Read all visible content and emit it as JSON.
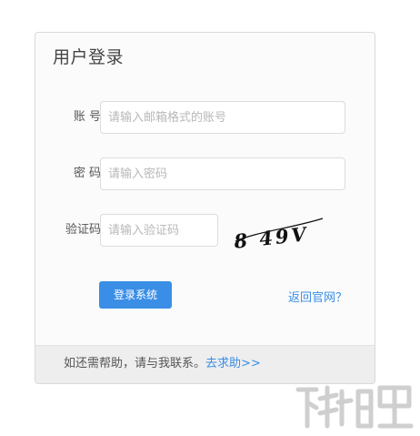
{
  "login": {
    "title": "用户登录",
    "account_label": "账 号",
    "account_placeholder": "请输入邮箱格式的账号",
    "password_label": "密 码",
    "password_placeholder": "请输入密码",
    "captcha_label": "验证码",
    "captcha_placeholder": "请输入验证码",
    "captcha_text": "8 49V",
    "submit_label": "登录系统",
    "back_link": "返回官网？"
  },
  "footer": {
    "help_text": "如还需帮助，请与我联系。",
    "help_link": "去求助>>"
  },
  "colors": {
    "accent": "#3a8ee6",
    "footer_bg": "#eeeeee",
    "card_bg": "#fbfbfb"
  }
}
